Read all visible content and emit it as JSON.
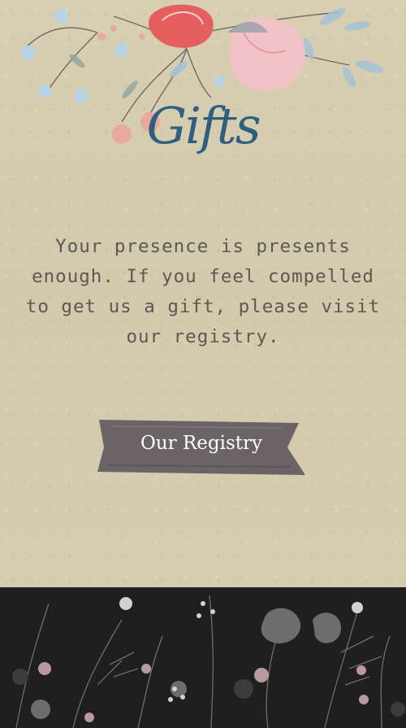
{
  "page": {
    "title": "Gifts",
    "message": "Your presence is presents enough. If you feel compelled to get us a gift, please visit our registry.",
    "registry_button_label": "Our Registry"
  },
  "colors": {
    "paper": "#d6ccb0",
    "title": "#2f5f7f",
    "message_text": "#5c5955",
    "button_fill": "#6b6466",
    "button_text": "#ffffff",
    "footer_band": "#1f1f1f"
  },
  "icons": {
    "floral_top": "watercolor-flowers-decoration",
    "floral_footer": "dark-floral-pattern"
  }
}
